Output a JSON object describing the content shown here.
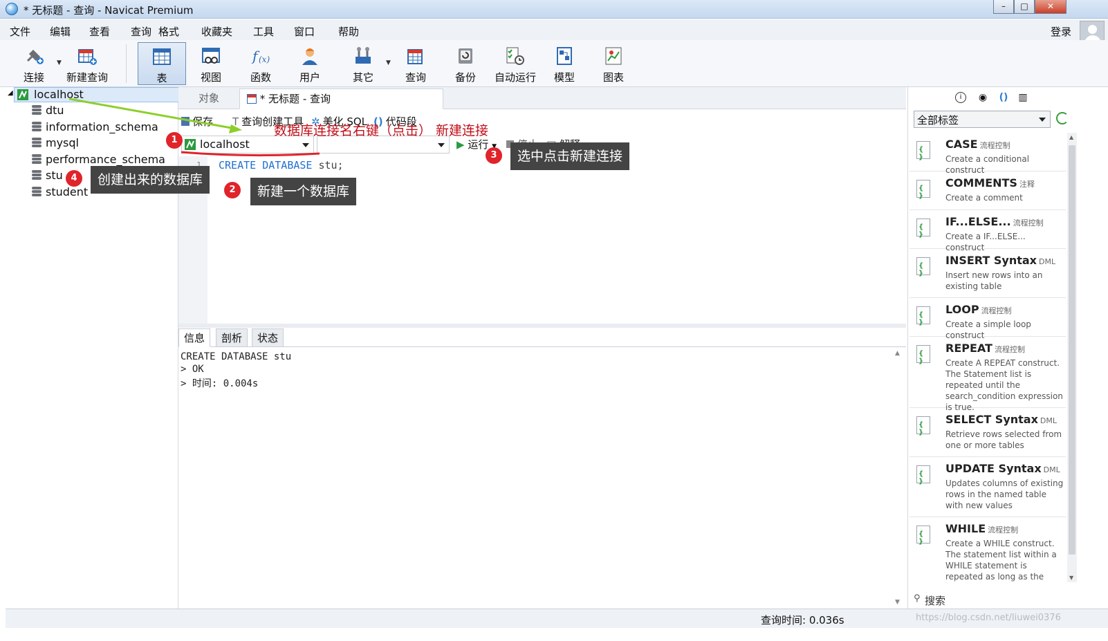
{
  "window": {
    "title": "* 无标题 - 查询 - Navicat Premium",
    "controls": [
      "–",
      "□",
      "✕"
    ]
  },
  "menu": {
    "items": [
      "文件",
      "编辑",
      "查看",
      "查询",
      "格式",
      "收藏夹",
      "工具",
      "窗口",
      "帮助"
    ],
    "login": "登录"
  },
  "toolbar": {
    "items": [
      "连接",
      "新建查询",
      "表",
      "视图",
      "函数",
      "用户",
      "其它",
      "查询",
      "备份",
      "自动运行",
      "模型",
      "图表"
    ],
    "active": "表"
  },
  "tree": {
    "root": "localhost",
    "databases": [
      "dtu",
      "information_schema",
      "mysql",
      "performance_schema",
      "stu",
      "student"
    ]
  },
  "tabs": {
    "objects": "对象",
    "query": "* 无标题 - 查询"
  },
  "query_toolbar": {
    "save": "保存",
    "builder": "查询创建工具",
    "beautify": "美化 SQL",
    "snippet": "代码段"
  },
  "connection_select": {
    "value": "localhost",
    "database_value": ""
  },
  "run_bar": {
    "run": "运行",
    "stop": "停止",
    "explain": "解释"
  },
  "editor": {
    "line_number": "1",
    "code_keyword": "CREATE DATABASE",
    "code_rest": " stu;"
  },
  "result_tabs": [
    "信息",
    "剖析",
    "状态"
  ],
  "result_lines": [
    "CREATE DATABASE stu",
    "> OK",
    "> 时间: 0.004s"
  ],
  "right_panel": {
    "tag_filter": "全部标签",
    "snippets": [
      {
        "name": "CASE",
        "tag": "流程控制",
        "desc": "Create a conditional construct"
      },
      {
        "name": "COMMENTS",
        "tag": "注释",
        "desc": "Create a comment"
      },
      {
        "name": "IF...ELSE...",
        "tag": "流程控制",
        "desc": "Create a IF...ELSE... construct"
      },
      {
        "name": "INSERT Syntax",
        "tag": "DML",
        "desc": "Insert new rows into an existing table"
      },
      {
        "name": "LOOP",
        "tag": "流程控制",
        "desc": "Create a simple loop construct"
      },
      {
        "name": "REPEAT",
        "tag": "流程控制",
        "desc": "Create A REPEAT construct. The Statement list is repeated until the search_condition expression is true."
      },
      {
        "name": "SELECT Syntax",
        "tag": "DML",
        "desc": "Retrieve rows selected from one or more tables"
      },
      {
        "name": "UPDATE Syntax",
        "tag": "DML",
        "desc": "Updates columns of existing rows in the named table with new values"
      },
      {
        "name": "WHILE",
        "tag": "流程控制",
        "desc": "Create a WHILE construct. The statement list within a WHILE statement is repeated as long as the search_condition expression"
      }
    ],
    "search": "搜索"
  },
  "status": {
    "query_time": "查询时间: 0.036s",
    "watermark": "https://blog.csdn.net/liuwei0376"
  },
  "annotations": {
    "n1": "1",
    "n2": "2",
    "n3": "3",
    "n4": "4",
    "top_note": "数据库连接名右键（点击） 新建连接",
    "box2": "新建一个数据库",
    "box3": "选中点击新建连接",
    "box4": "创建出来的数据库"
  },
  "colors": {
    "keyword": "#1f6fd1",
    "annotation_red": "#e0242a",
    "arrow": "#8ccf2a"
  }
}
